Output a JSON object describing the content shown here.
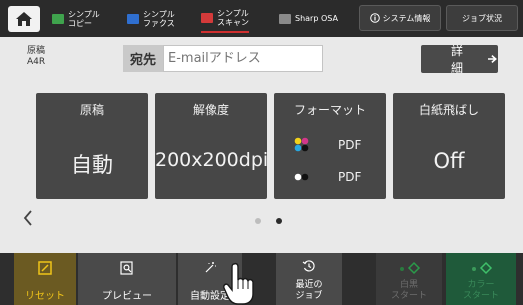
{
  "topbar": {
    "tabs": [
      {
        "label": "シンプル\nコピー",
        "color": "#3fa34d"
      },
      {
        "label": "シンプル\nファクス",
        "color": "#2f6fd0"
      },
      {
        "label": "シンプル\nスキャン",
        "color": "#d43a3a",
        "active": true
      },
      {
        "label": "Sharp OSA",
        "color": "#8a8a8a"
      }
    ],
    "system_info": "システム情報",
    "job_status": "ジョブ状況"
  },
  "original": {
    "label": "原稿",
    "size": "A4R"
  },
  "destination": {
    "label": "宛先",
    "placeholder": "E-mailアドレス"
  },
  "detail_label": "詳細",
  "cards": {
    "original": {
      "title": "原稿",
      "value": "自動"
    },
    "resolution": {
      "title": "解像度",
      "value": "200x200dpi"
    },
    "format": {
      "title": "フォーマット",
      "color_value": "PDF",
      "mono_value": "PDF"
    },
    "blank_skip": {
      "title": "白紙飛ばし",
      "value": "Off"
    }
  },
  "pager": {
    "pages": 2,
    "current": 2
  },
  "bottom": {
    "reset": "リセット",
    "preview": "プレビュー",
    "auto_settings": "自動設定",
    "recent_job_line1": "最近の",
    "recent_job_line2": "ジョブ",
    "mono_start_line1": "白黒",
    "mono_start_line2": "スタート",
    "color_start_line1": "カラー",
    "color_start_line2": "スタート"
  },
  "colors": {
    "accent_red": "#cf2f2f",
    "start_green": "#2fae5a"
  }
}
